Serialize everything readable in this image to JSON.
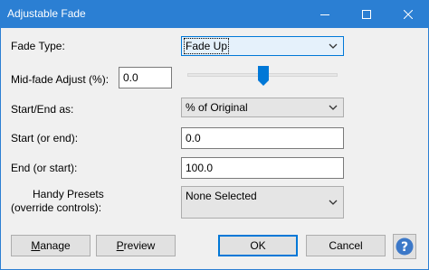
{
  "window": {
    "title": "Adjustable Fade",
    "minimize_icon": "minimize-icon",
    "maximize_icon": "maximize-icon",
    "close_icon": "close-icon"
  },
  "form": {
    "fade_type": {
      "label": "Fade Type:",
      "value": "Fade Up"
    },
    "mid_fade": {
      "label": "Mid-fade Adjust (%):",
      "value": "0.0",
      "slider_level_percent": 50
    },
    "start_end_as": {
      "label": "Start/End as:",
      "value": "% of Original"
    },
    "start": {
      "label": "Start (or end):",
      "value": "0.0"
    },
    "end": {
      "label": "End (or start):",
      "value": "100.0"
    },
    "presets": {
      "label_line1": "Handy Presets",
      "label_line2": "(override controls):",
      "value": "None Selected"
    }
  },
  "buttons": {
    "manage": {
      "first": "M",
      "rest": "anage"
    },
    "preview": {
      "first": "P",
      "rest": "review"
    },
    "ok": "OK",
    "cancel": "Cancel",
    "help_icon": "help-icon"
  },
  "colors": {
    "titlebar": "#2b7fd3",
    "accent": "#0078d7",
    "dialog_bg": "#f0f0f0",
    "help_icon": "#3c78c8"
  }
}
